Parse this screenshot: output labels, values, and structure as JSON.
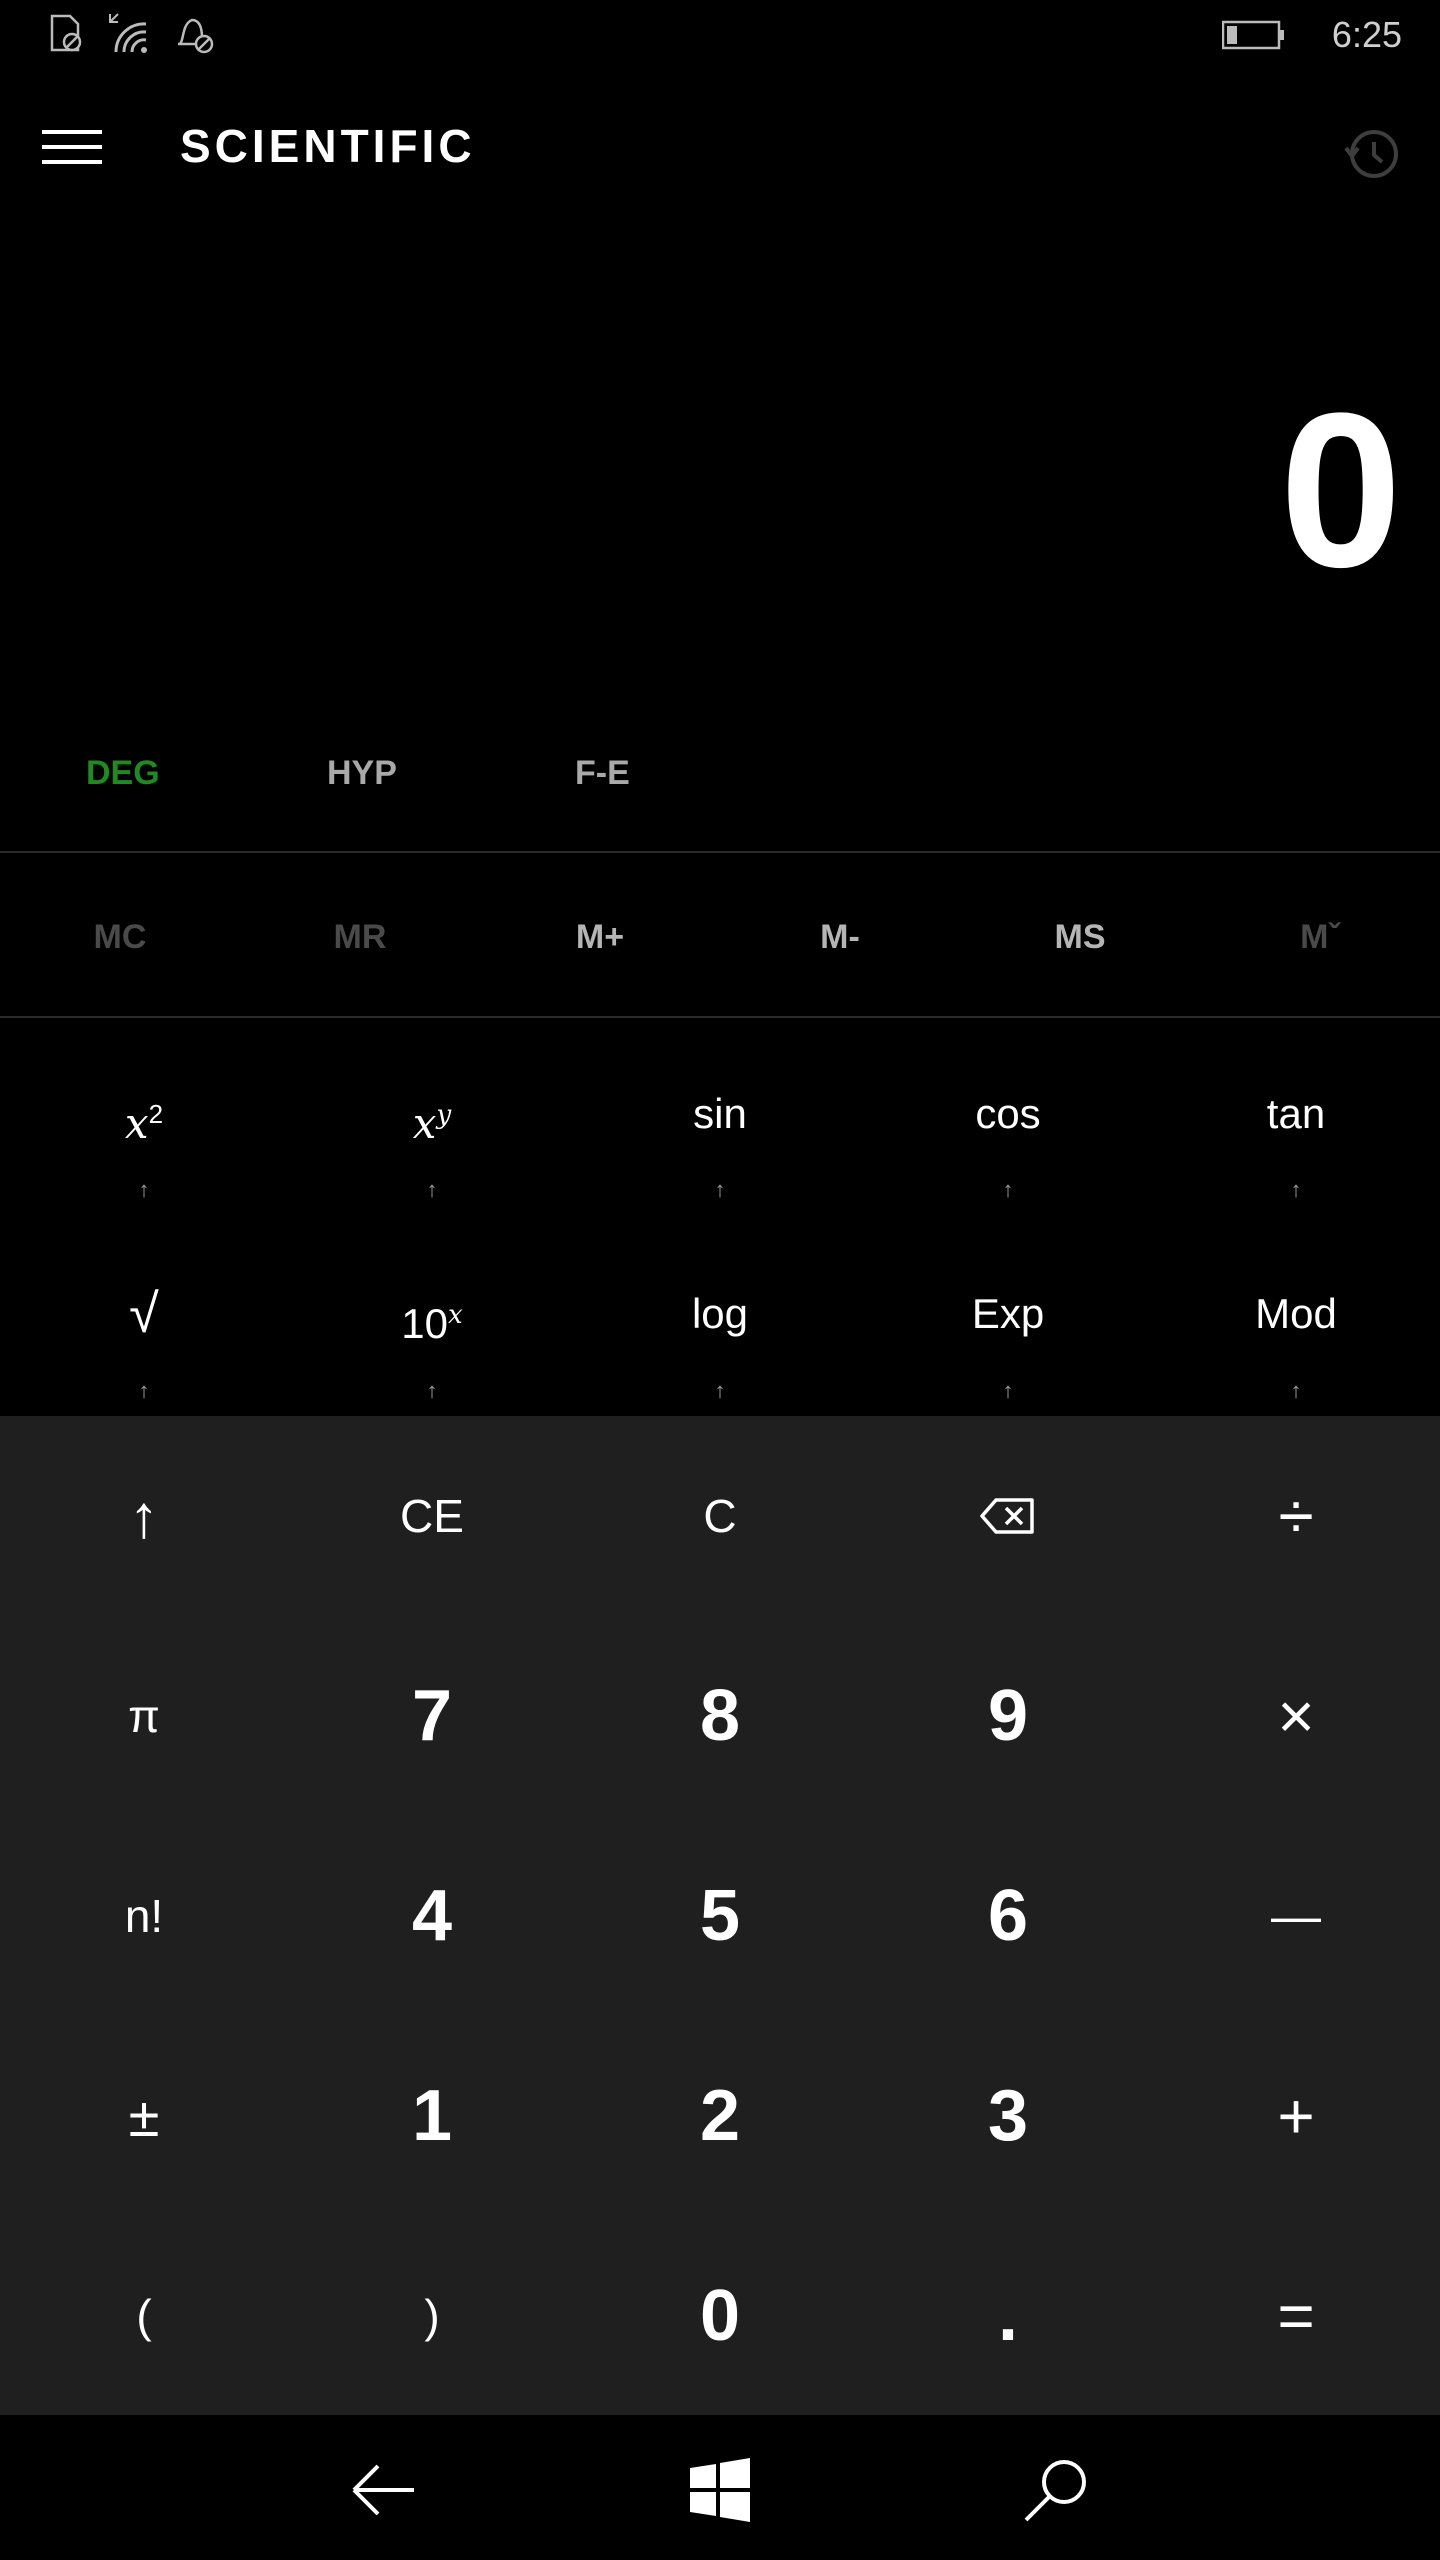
{
  "status": {
    "time": "6:25"
  },
  "header": {
    "title": "SCIENTIFIC"
  },
  "display": {
    "value": "0"
  },
  "modes": {
    "angle": "DEG",
    "hyp": "HYP",
    "fe": "F-E"
  },
  "memory": {
    "mc": "MC",
    "mr": "MR",
    "mplus": "M+",
    "mminus": "M-",
    "ms": "MS",
    "mlist": "Mˇ"
  },
  "functions": {
    "sin": "sin",
    "cos": "cos",
    "tan": "tan",
    "sqrt": "√",
    "ten": "10",
    "log": "log",
    "exp": "Exp",
    "mod": "Mod",
    "shift_caret": "↑"
  },
  "keys": {
    "shift": "↑",
    "ce": "CE",
    "c": "C",
    "backspace_icon": "backspace-icon",
    "divide": "÷",
    "pi": "π",
    "seven": "7",
    "eight": "8",
    "nine": "9",
    "multiply": "×",
    "fact": "n!",
    "four": "4",
    "five": "5",
    "six": "6",
    "minus": "—",
    "plusminus": "±",
    "one": "1",
    "two": "2",
    "three": "3",
    "plus": "+",
    "lparen": "(",
    "rparen": ")",
    "zero": "0",
    "dot": ".",
    "equals": "="
  },
  "colors": {
    "accent": "#1f8a1f",
    "keypad_bg": "#1f1f1f",
    "background": "#000000"
  }
}
